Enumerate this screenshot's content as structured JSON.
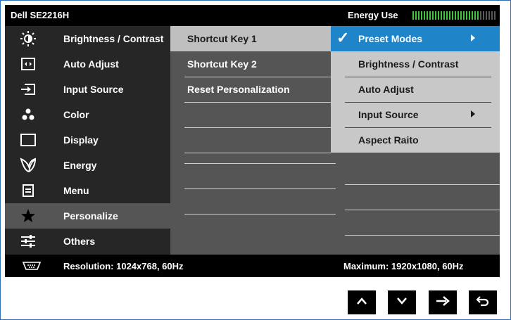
{
  "header": {
    "model": "Dell SE2216H",
    "energy_label": "Energy Use",
    "energy_level_fraction": 0.8
  },
  "sidebar": {
    "items": [
      {
        "label": "Brightness / Contrast",
        "icon": "brightness-icon"
      },
      {
        "label": "Auto Adjust",
        "icon": "auto-adjust-icon"
      },
      {
        "label": "Input Source",
        "icon": "input-source-icon"
      },
      {
        "label": "Color",
        "icon": "color-icon"
      },
      {
        "label": "Display",
        "icon": "display-icon"
      },
      {
        "label": "Energy",
        "icon": "energy-leaf-icon"
      },
      {
        "label": "Menu",
        "icon": "menu-icon"
      },
      {
        "label": "Personalize",
        "icon": "star-icon",
        "active": true
      },
      {
        "label": "Others",
        "icon": "sliders-icon"
      }
    ]
  },
  "shortcuts": {
    "items": [
      {
        "label": "Shortcut Key 1",
        "selected": true
      },
      {
        "label": "Shortcut Key 2"
      },
      {
        "label": "Reset Personalization"
      }
    ]
  },
  "options": {
    "items": [
      {
        "label": "Preset Modes",
        "selected": true,
        "submenu": true
      },
      {
        "label": "Brightness / Contrast"
      },
      {
        "label": "Auto Adjust"
      },
      {
        "label": "Input Source",
        "submenu": true
      },
      {
        "label": "Aspect Raito"
      }
    ]
  },
  "status": {
    "resolution": "Resolution: 1024x768, 60Hz",
    "maximum": "Maximum: 1920x1080, 60Hz",
    "icon": "vga-connector-icon"
  },
  "nav_buttons": [
    {
      "name": "up-button",
      "icon": "arrow-up-icon"
    },
    {
      "name": "down-button",
      "icon": "arrow-down-icon"
    },
    {
      "name": "right-button",
      "icon": "arrow-right-icon"
    },
    {
      "name": "back-button",
      "icon": "back-return-icon"
    }
  ],
  "colors": {
    "osd_background": "#1b1b1b",
    "sidebar_background": "#262626",
    "panel_background": "#555555",
    "highlight_blue": "#1f84c8",
    "energy_green": "#43c43d",
    "frame_border": "#2f6fb5"
  }
}
